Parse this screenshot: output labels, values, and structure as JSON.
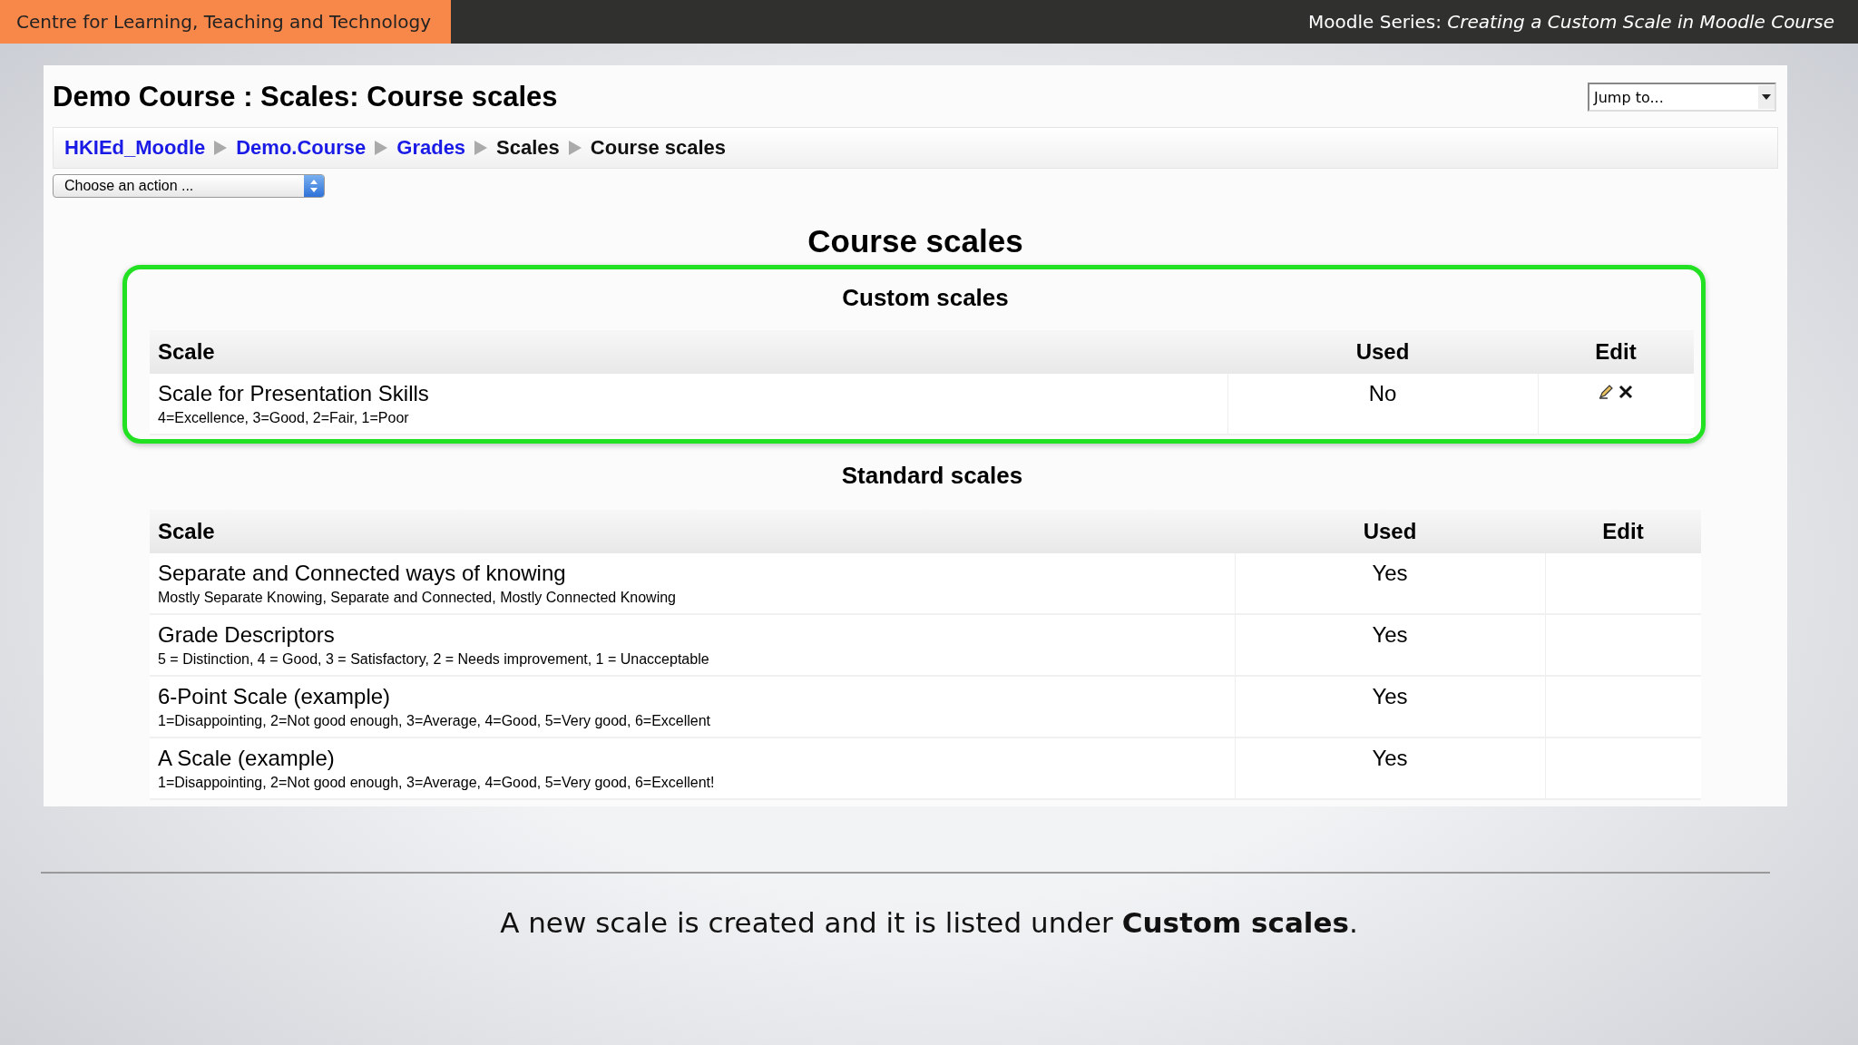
{
  "header": {
    "org": "Centre for Learning, Teaching and Technology",
    "series_label": "Moodle Series:",
    "series_title": "Creating a Custom Scale in Moodle Course"
  },
  "page": {
    "title": "Demo Course : Scales: Course scales",
    "jump_to": {
      "placeholder": "Jump to..."
    },
    "breadcrumb": [
      {
        "label": "HKIEd_Moodle",
        "link": true
      },
      {
        "label": "Demo.Course",
        "link": true
      },
      {
        "label": "Grades",
        "link": true
      },
      {
        "label": "Scales",
        "link": false
      },
      {
        "label": "Course scales",
        "link": false
      }
    ],
    "action_select": {
      "value": "Choose an action ..."
    },
    "heading": "Course scales",
    "sections": [
      {
        "title": "Custom scales",
        "highlighted": true,
        "columns": [
          "Scale",
          "Used",
          "Edit"
        ],
        "rows": [
          {
            "name": "Scale for Presentation Skills",
            "description": "4=Excellence, 3=Good, 2=Fair, 1=Poor",
            "used": "No",
            "editable": true
          }
        ]
      },
      {
        "title": "Standard scales",
        "highlighted": false,
        "columns": [
          "Scale",
          "Used",
          "Edit"
        ],
        "rows": [
          {
            "name": "Separate and Connected ways of knowing",
            "description": "Mostly Separate Knowing, Separate and Connected, Mostly Connected Knowing",
            "used": "Yes",
            "editable": false
          },
          {
            "name": "Grade Descriptors",
            "description": "5 = Distinction, 4 = Good, 3 = Satisfactory, 2 = Needs improvement, 1 = Unacceptable",
            "used": "Yes",
            "editable": false
          },
          {
            "name": "6-Point Scale (example)",
            "description": "1=Disappointing, 2=Not good enough, 3=Average, 4=Good, 5=Very good, 6=Excellent",
            "used": "Yes",
            "editable": false
          },
          {
            "name": "A Scale (example)",
            "description": "1=Disappointing, 2=Not good enough, 3=Average, 4=Good, 5=Very good, 6=Excellent!",
            "used": "Yes",
            "editable": false
          }
        ]
      }
    ]
  },
  "caption": "A new scale is created and it is listed under **Custom scales**."
}
